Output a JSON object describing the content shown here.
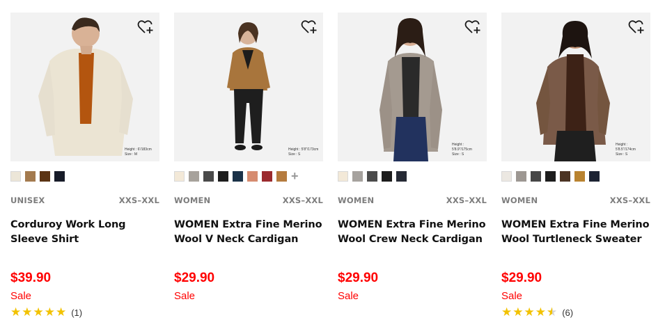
{
  "products": [
    {
      "gender": "UNISEX",
      "size_range": "XXS–XXL",
      "name": "Corduroy Work Long Sleeve Shirt",
      "price": "$39.90",
      "sale_label": "Sale",
      "rating": 5,
      "review_count": "(1)",
      "model_height": "Height : 6'/183cm",
      "model_size": "Size : M",
      "swatches": [
        "#ece6d8",
        "#a37a4e",
        "#5b3414",
        "#171b28"
      ],
      "more_colors": false
    },
    {
      "gender": "WOMEN",
      "size_range": "XXS–XXL",
      "name": "WOMEN Extra Fine Merino Wool V Neck Cardigan",
      "price": "$29.90",
      "sale_label": "Sale",
      "rating": null,
      "review_count": null,
      "model_height": "Height : 5'8\"/173cm",
      "model_size": "Size : S",
      "swatches": [
        "#f3e9d8",
        "#a7a29c",
        "#4a4a4a",
        "#1d1d1d",
        "#1b3248",
        "#d68c70",
        "#9b2a2e",
        "#b57b3e"
      ],
      "more_colors": true,
      "more_label": "+"
    },
    {
      "gender": "WOMEN",
      "size_range": "XXS–XXL",
      "name": "WOMEN Extra Fine Merino Wool Crew Neck Cardigan",
      "price": "$29.90",
      "sale_label": "Sale",
      "rating": null,
      "review_count": null,
      "model_height": "Height : 5'8.9\"/175cm",
      "model_size": "Size : S",
      "swatches": [
        "#f3e9d8",
        "#a6a29e",
        "#4b4b4b",
        "#1d1d1d",
        "#262a35"
      ],
      "more_colors": false
    },
    {
      "gender": "WOMEN",
      "size_range": "XXS–XXL",
      "name": "WOMEN Extra Fine Merino Wool Turtleneck Sweater",
      "price": "$29.90",
      "sale_label": "Sale",
      "rating": 4.5,
      "review_count": "(6)",
      "model_height": "Height : 5'8.5\"/174cm",
      "model_size": "Size : S",
      "swatches": [
        "#ece8e2",
        "#9d9792",
        "#474747",
        "#1d1d1d",
        "#4c3424",
        "#b98330",
        "#1c2333"
      ],
      "more_colors": false
    }
  ],
  "colors": {
    "price": "#ff0000",
    "star": "#f2c200",
    "meta": "#7d7d7d"
  },
  "icons": {
    "favorite": "heart-plus-icon"
  }
}
